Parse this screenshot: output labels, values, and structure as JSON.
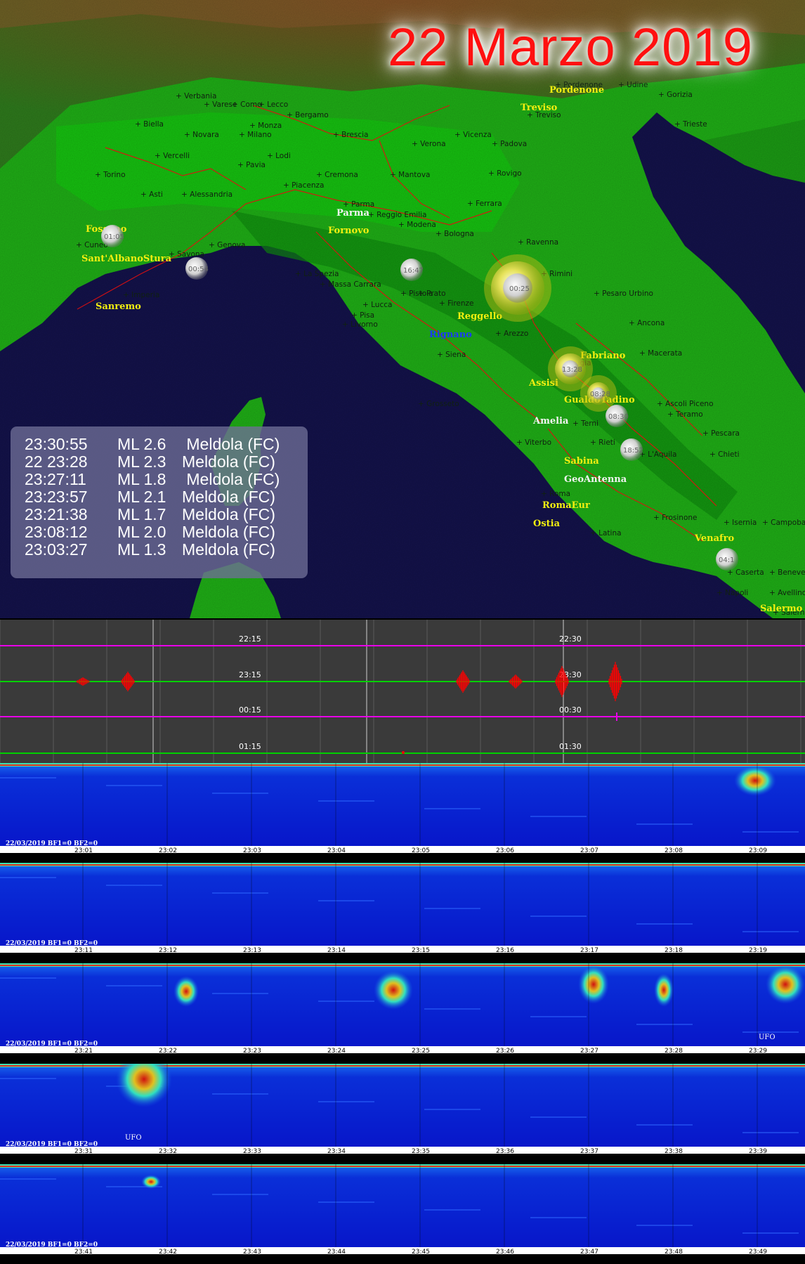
{
  "title": "22 Marzo 2019",
  "colors": {
    "land": "#1fae16",
    "sea": "#13124a",
    "highlight_label": "#f2ee10",
    "trace_pink": "#e800e8",
    "trace_green": "#00d000",
    "event_red": "#ff0000",
    "spec_bg": "#0a1fd0"
  },
  "map": {
    "stations": [
      {
        "name": "Pordenone",
        "color": "yellow"
      },
      {
        "name": "Treviso",
        "color": "yellow"
      },
      {
        "name": "Parma",
        "color": "white"
      },
      {
        "name": "Fornovo",
        "color": "yellow"
      },
      {
        "name": "Fossano",
        "color": "yellow"
      },
      {
        "name": "Sant'AlbanoStura",
        "color": "yellow"
      },
      {
        "name": "Sanremo",
        "color": "yellow"
      },
      {
        "name": "Reggello",
        "color": "yellow"
      },
      {
        "name": "Rignano",
        "color": "blue"
      },
      {
        "name": "Fabriano",
        "color": "yellow"
      },
      {
        "name": "Assisi",
        "color": "yellow"
      },
      {
        "name": "GualdoTadino",
        "color": "yellow"
      },
      {
        "name": "Amelia",
        "color": "white"
      },
      {
        "name": "Sabina",
        "color": "yellow"
      },
      {
        "name": "GeoAntenna",
        "color": "white"
      },
      {
        "name": "RomaEur",
        "color": "yellow"
      },
      {
        "name": "Ostia",
        "color": "yellow"
      },
      {
        "name": "Venafro",
        "color": "yellow"
      },
      {
        "name": "Salermo",
        "color": "yellow"
      }
    ],
    "cities": [
      "Verbania",
      "Varese",
      "Como",
      "Lecco",
      "Bergamo",
      "Biella",
      "Monza",
      "Novara",
      "Milano",
      "Brescia",
      "Vercelli",
      "Lodi",
      "Pavia",
      "Torino",
      "Asti",
      "Alessandria",
      "Cremona",
      "Mantova",
      "Piacenza",
      "Verona",
      "Vicenza",
      "Padova",
      "Rovigo",
      "Treviso",
      "Pordenone",
      "Udine",
      "Gorizia",
      "Trieste",
      "Ferrara",
      "Parma",
      "Reggio Emilia",
      "Modena",
      "Bologna",
      "Ravenna",
      "Cuneo",
      "Genova",
      "Savona",
      "Imperia",
      "La Spezia",
      "Massa Carrara",
      "Lucca",
      "Pisa",
      "Pistoia",
      "Prato",
      "Firenze",
      "Livorno",
      "Rimini",
      "Pesaro Urbino",
      "Ancona",
      "Arezzo",
      "Siena",
      "Macerata",
      "Perugia",
      "Ascoli Piceno",
      "Teramo",
      "Grosseto",
      "Terni",
      "Pescara",
      "Viterbo",
      "Rieti",
      "Roma",
      "Chieti",
      "Isernia",
      "Campobasso",
      "Latina",
      "Caserta",
      "Benevento",
      "Napoli",
      "Avellino",
      "Salerno",
      "Frosinone",
      "L'Aquila"
    ],
    "events": [
      {
        "label": "00:25",
        "size": "large",
        "color": "yellow"
      },
      {
        "label": "13:28",
        "size": "medium",
        "color": "yellow"
      },
      {
        "label": "08:28",
        "size": "small",
        "color": "yellow"
      },
      {
        "label": "08:30",
        "size": "small",
        "color": "gray"
      },
      {
        "label": "01:05",
        "size": "small",
        "color": "gray"
      },
      {
        "label": "16:47",
        "size": "small",
        "color": "gray"
      },
      {
        "label": "04:1",
        "size": "small",
        "color": "gray"
      },
      {
        "label": "18:52",
        "size": "small",
        "color": "gray"
      },
      {
        "label": "00:54",
        "size": "small",
        "color": "gray"
      }
    ]
  },
  "quake_list": [
    {
      "time": "23:30:55",
      "mag": "ML 2.6",
      "place": " Meldola (FC)"
    },
    {
      "time": "22 23:28",
      "mag": "ML 2.3",
      "place": "Meldola (FC)"
    },
    {
      "time": "23:27:11",
      "mag": "ML 1.8",
      "place": " Meldola (FC)"
    },
    {
      "time": "23:23:57",
      "mag": "ML 2.1",
      "place": "Meldola (FC)"
    },
    {
      "time": "23:21:38",
      "mag": "ML 1.7",
      "place": "Meldola (FC)"
    },
    {
      "time": "23:08:12",
      "mag": "ML 2.0",
      "place": "Meldola (FC)"
    },
    {
      "time": "23:03:27",
      "mag": "ML 1.3",
      "place": "Meldola (FC)"
    }
  ],
  "seismogram": {
    "rows": [
      {
        "left": "22:15",
        "right": "22:30",
        "color": "pink"
      },
      {
        "left": "23:15",
        "right": "23:30",
        "color": "green"
      },
      {
        "left": "00:15",
        "right": "00:30",
        "color": "pink"
      },
      {
        "left": "01:15",
        "right": "01:30",
        "color": "green"
      }
    ]
  },
  "spectrograms": [
    {
      "date": "22/03/2019 BF1=0 BF2=0",
      "ticks": [
        "23:01",
        "23:02",
        "23:03",
        "23:04",
        "23:05",
        "23:06",
        "23:07",
        "23:08",
        "23:09"
      ],
      "annotation": ""
    },
    {
      "date": "22/03/2019 BF1=0 BF2=0",
      "ticks": [
        "23:11",
        "23:12",
        "23:13",
        "23:14",
        "23:15",
        "23:16",
        "23:17",
        "23:18",
        "23:19"
      ],
      "annotation": ""
    },
    {
      "date": "22/03/2019 BF1=0 BF2=0",
      "ticks": [
        "23:21",
        "23:22",
        "23:23",
        "23:24",
        "23:25",
        "23:26",
        "23:27",
        "23:28",
        "23:29"
      ],
      "annotation": "UFO"
    },
    {
      "date": "22/03/2019 BF1=0 BF2=0",
      "ticks": [
        "23:31",
        "23:32",
        "23:33",
        "23:34",
        "23:35",
        "23:36",
        "23:37",
        "23:38",
        "23:39"
      ],
      "annotation": "UFO"
    },
    {
      "date": "22/03/2019 BF1=0 BF2=0",
      "ticks": [
        "23:41",
        "23:42",
        "23:43",
        "23:44",
        "23:45",
        "23:46",
        "23:47",
        "23:48",
        "23:49"
      ],
      "annotation": ""
    }
  ]
}
